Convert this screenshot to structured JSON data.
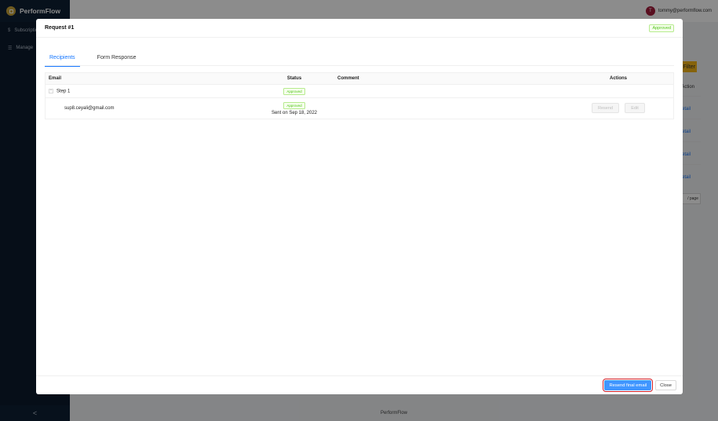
{
  "app": {
    "name": "PerformFlow"
  },
  "sidebar": {
    "items": [
      {
        "icon": "dollar-icon",
        "label": "Subscriptions"
      },
      {
        "icon": "list-icon",
        "label": "Manage"
      }
    ],
    "collapse_label": "<"
  },
  "header": {
    "avatar_initial": "T",
    "user_email": "tommy@performflow.com"
  },
  "background": {
    "filter_label": "Filter",
    "column_label": "Action",
    "detail_link": "Detail",
    "page_size": "/ page"
  },
  "footer": {
    "text": "PerformFlow"
  },
  "modal": {
    "title": "Request #1",
    "status_tag": "Approved",
    "tabs": [
      "Recipients",
      "Form Response"
    ],
    "table": {
      "headers": {
        "email": "Email",
        "status": "Status",
        "comment": "Comment",
        "actions": "Actions"
      },
      "group": {
        "expand_symbol": "-",
        "label": "Step 1",
        "status": "Approved"
      },
      "rows": [
        {
          "email": "sup8.ceyali@gmail.com",
          "status": "Approved",
          "sent": "Sent on Sep 18, 2022",
          "resend": "Resend",
          "edit": "Edit"
        }
      ]
    },
    "footer": {
      "primary": "Resend final email",
      "close": "Close"
    }
  }
}
